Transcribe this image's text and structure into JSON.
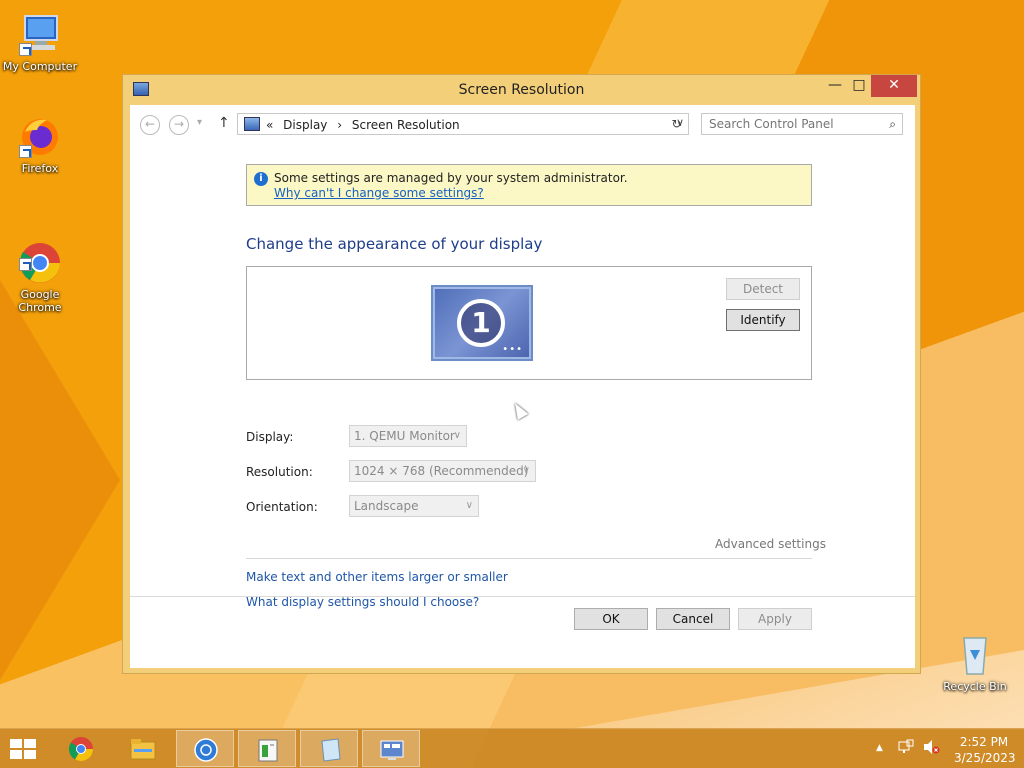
{
  "desktop": {
    "icons": [
      {
        "label": "My Computer"
      },
      {
        "label": "Firefox"
      },
      {
        "label": "Google\nChrome"
      },
      {
        "label": "Recycle Bin"
      }
    ]
  },
  "window": {
    "title": "Screen Resolution",
    "controls": {
      "minimize": "—",
      "maximize": "□",
      "close": "✕"
    }
  },
  "nav": {
    "back": "←",
    "forward": "→",
    "recent": "▾",
    "up": "↑",
    "breadcrumb_prefix": "«",
    "breadcrumbs": [
      "Display",
      "›",
      "Screen Resolution"
    ],
    "address_dropdown": "∨",
    "refresh": "↻",
    "search_placeholder": "Search Control Panel",
    "search_icon": "⌕"
  },
  "info": {
    "message": "Some settings are managed by your system administrator.",
    "link": "Why can't I change some settings?"
  },
  "main": {
    "heading": "Change the appearance of your display",
    "monitor_number": "1",
    "detect_label": "Detect",
    "identify_label": "Identify",
    "display_label": "Display:",
    "display_value": "1. QEMU Monitor",
    "resolution_label": "Resolution:",
    "resolution_value": "1024 × 768 (Recommended)",
    "orientation_label": "Orientation:",
    "orientation_value": "Landscape",
    "advanced_label": "Advanced settings",
    "link_text_size": "Make text and other items larger or smaller",
    "link_help": "What display settings should I choose?"
  },
  "footer": {
    "ok_label": "OK",
    "cancel_label": "Cancel",
    "apply_label": "Apply"
  },
  "taskbar": {
    "time": "2:52 PM",
    "date": "3/25/2023",
    "tray_up": "▲"
  },
  "colors": {
    "desktop": "#f4a60a",
    "window_frame": "#f3cf7a",
    "close_button": "#c7463f",
    "link": "#1e56a8",
    "heading": "#1e3d8a",
    "info_bg": "#fbf8c5"
  }
}
